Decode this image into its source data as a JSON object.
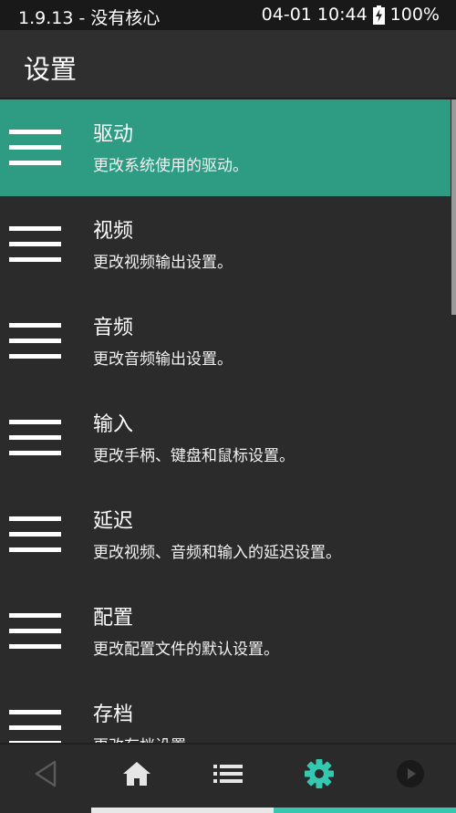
{
  "status_bar": {
    "left_text": "1.9.13 - 没有核心",
    "right_text": "04-01 10:44",
    "battery_percent": "100%",
    "battery_icon": "battery-charging-icon"
  },
  "app_bar": {
    "title": "设置"
  },
  "settings_items": [
    {
      "title": "驱动",
      "subtitle": "更改系统使用的驱动。",
      "selected": true
    },
    {
      "title": "视频",
      "subtitle": "更改视频输出设置。",
      "selected": false
    },
    {
      "title": "音频",
      "subtitle": "更改音频输出设置。",
      "selected": false
    },
    {
      "title": "输入",
      "subtitle": "更改手柄、键盘和鼠标设置。",
      "selected": false
    },
    {
      "title": "延迟",
      "subtitle": "更改视频、音频和输入的延迟设置。",
      "selected": false
    },
    {
      "title": "配置",
      "subtitle": "更改配置文件的默认设置。",
      "selected": false
    },
    {
      "title": "存档",
      "subtitle": "更改存档设置。",
      "selected": false
    }
  ],
  "bottom_nav": {
    "items": [
      {
        "icon": "back-triangle-icon",
        "active": false
      },
      {
        "icon": "home-icon",
        "active": false
      },
      {
        "icon": "list-icon",
        "active": false
      },
      {
        "icon": "gear-icon",
        "active": true
      },
      {
        "icon": "play-circle-icon",
        "active": false
      }
    ]
  },
  "colors": {
    "accent": "#2e9c82",
    "nav_active": "#35c8b0",
    "background": "#2b2b2b"
  }
}
